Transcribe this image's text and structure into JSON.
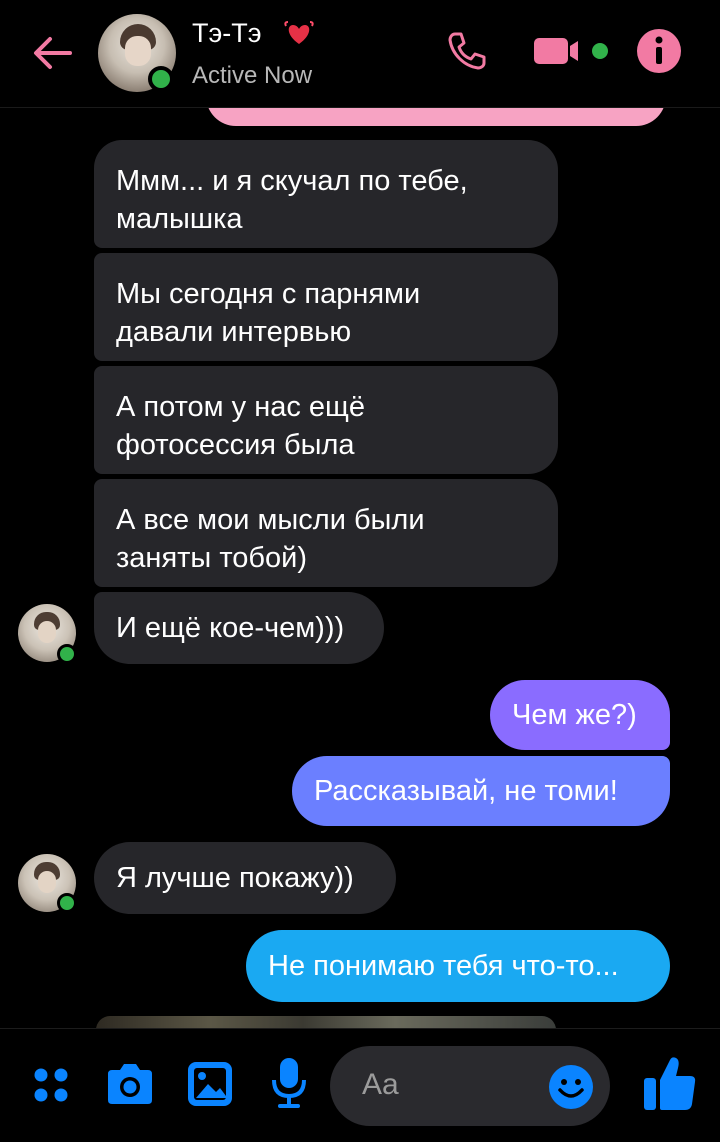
{
  "header": {
    "contact_name": "Тэ-Тэ",
    "status": "Active Now",
    "icons": [
      "back-arrow-icon",
      "heart-icon",
      "phone-icon",
      "video-camera-icon",
      "info-icon"
    ]
  },
  "messages": [
    {
      "from": "them",
      "text_lines": [
        "Ммм... и я скучал по тебе,",
        "малышка"
      ]
    },
    {
      "from": "them",
      "text_lines": [
        "Мы сегодня с парнями",
        "давали интервью"
      ]
    },
    {
      "from": "them",
      "text_lines": [
        "А потом у нас ещё",
        "фотосессия была"
      ]
    },
    {
      "from": "them",
      "text_lines": [
        "А все мои мысли были",
        "заняты тобой)"
      ]
    },
    {
      "from": "them",
      "text_lines": [
        "И ещё кое-чем)))"
      ]
    },
    {
      "from": "me",
      "text_lines": [
        "Чем же?)"
      ]
    },
    {
      "from": "me",
      "text_lines": [
        "Рассказывай, не томи!"
      ]
    },
    {
      "from": "them",
      "text_lines": [
        "Я лучше покажу))"
      ]
    },
    {
      "from": "me",
      "text_lines": [
        "Не понимаю тебя что-то..."
      ]
    }
  ],
  "composer": {
    "placeholder": "Aa",
    "icons": [
      "apps-icon",
      "camera-icon",
      "gallery-icon",
      "microphone-icon",
      "emoji-icon",
      "thumbs-up-icon"
    ]
  },
  "colors": {
    "accent": "#0a84ff",
    "incoming_bubble": "#26262a",
    "online": "#31b24a",
    "back_arrow": "#f27aa3",
    "sent_gradient_top": "#8a6cff",
    "sent_gradient_bottom": "#1aa9f2"
  }
}
